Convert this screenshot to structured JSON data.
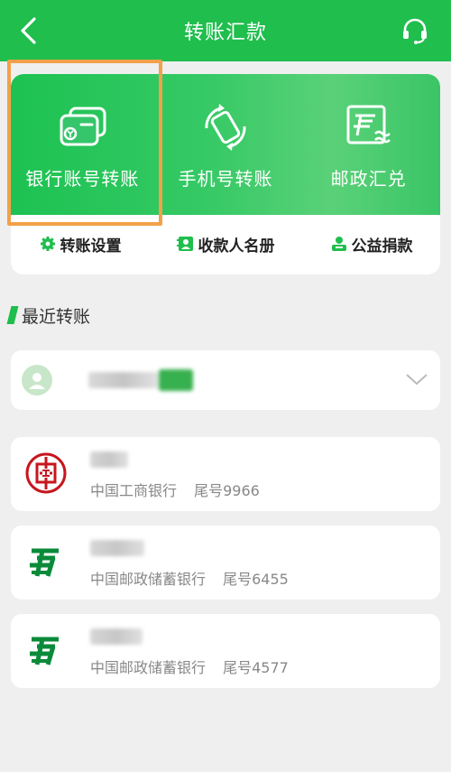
{
  "header": {
    "title": "转账汇款",
    "back_icon": "chevron-left-icon",
    "service_icon": "headset-icon"
  },
  "banner": {
    "items": [
      {
        "label": "银行账号转账",
        "icon": "bank-card-icon"
      },
      {
        "label": "手机号转账",
        "icon": "phone-rotate-icon"
      },
      {
        "label": "邮政汇兑",
        "icon": "postal-remit-icon"
      }
    ]
  },
  "quick": {
    "items": [
      {
        "label": "转账设置",
        "icon": "gear-icon"
      },
      {
        "label": "收款人名册",
        "icon": "contacts-book-icon"
      },
      {
        "label": "公益捐款",
        "icon": "donation-icon"
      }
    ]
  },
  "recent": {
    "title": "最近转账"
  },
  "payees": [
    {
      "bank": "中国工商银行",
      "tail": "尾号9966",
      "logo": "icbc-logo-icon"
    },
    {
      "bank": "中国邮政储蓄银行",
      "tail": "尾号6455",
      "logo": "psbc-logo-icon"
    },
    {
      "bank": "中国邮政储蓄银行",
      "tail": "尾号4577",
      "logo": "psbc-logo-icon"
    }
  ],
  "colors": {
    "brand_green": "#1fbe4d",
    "highlight_orange": "#f2a14a",
    "icbc_red": "#c7161e",
    "psbc_green": "#0a8a3a"
  }
}
